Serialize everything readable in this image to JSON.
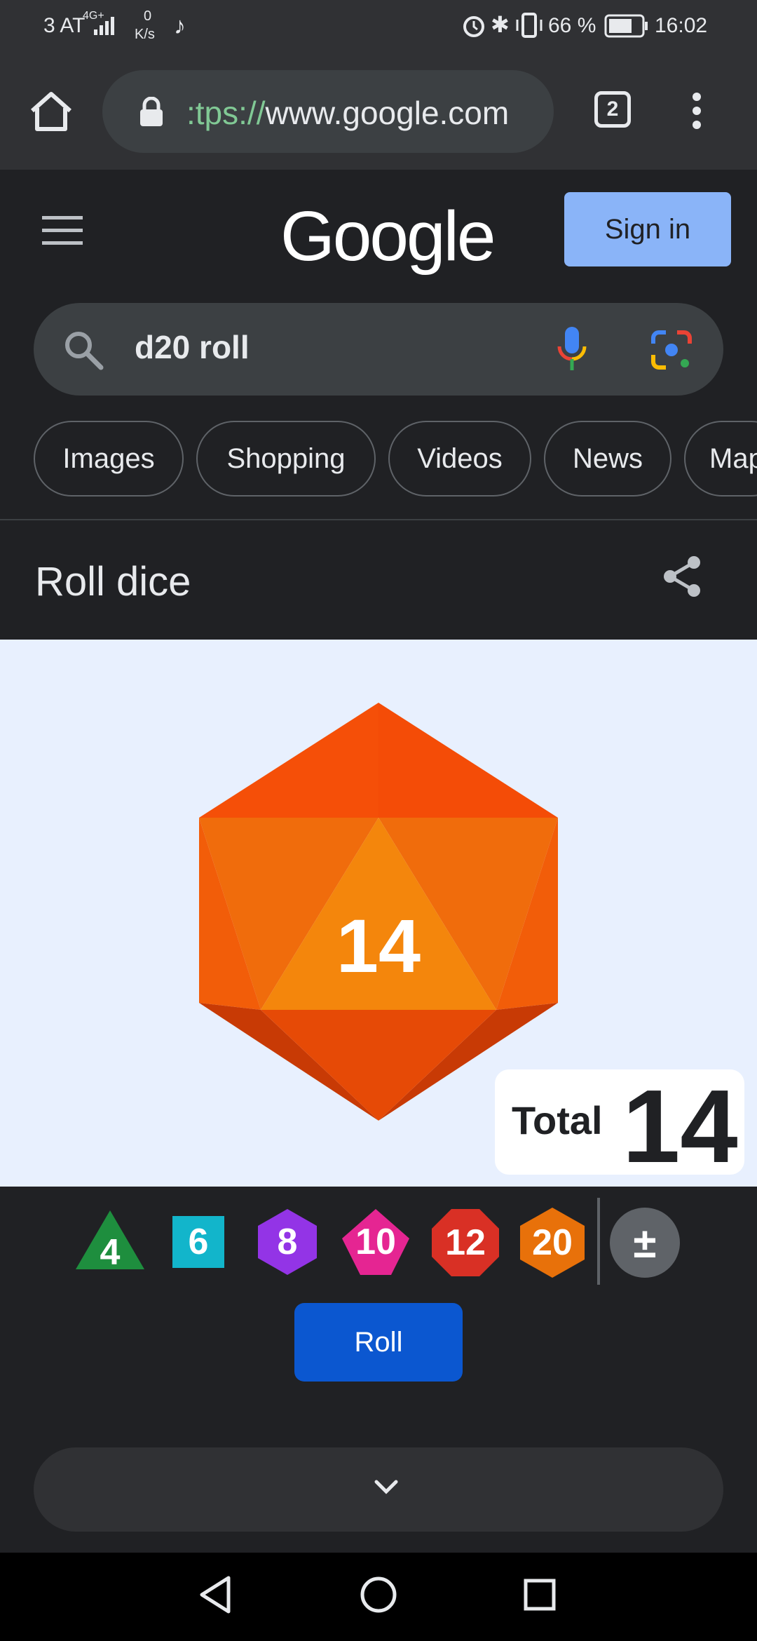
{
  "status_bar": {
    "carrier": "3 AT",
    "network": "4G+",
    "data_rate": "0",
    "data_rate_unit": "K/s",
    "battery": "66 %",
    "time": "16:02"
  },
  "browser": {
    "url_scheme": ":tps://",
    "url_host": "www.google.com",
    "tab_count": "2"
  },
  "header": {
    "logo": "Google",
    "signin_label": "Sign in"
  },
  "search": {
    "query": "d20 roll"
  },
  "chips": [
    "Images",
    "Shopping",
    "Videos",
    "News",
    "Map"
  ],
  "roll_dice": {
    "title": "Roll dice",
    "die_result": "14",
    "total_label": "Total",
    "total_value": "14",
    "dice_options": [
      {
        "sides": "4",
        "color": "#1e8e3e"
      },
      {
        "sides": "6",
        "color": "#12b5cb"
      },
      {
        "sides": "8",
        "color": "#9334e6"
      },
      {
        "sides": "10",
        "color": "#e52592"
      },
      {
        "sides": "12",
        "color": "#d93025"
      },
      {
        "sides": "20",
        "color": "#e8710a"
      }
    ],
    "modifier_symbol": "±",
    "roll_label": "Roll"
  }
}
